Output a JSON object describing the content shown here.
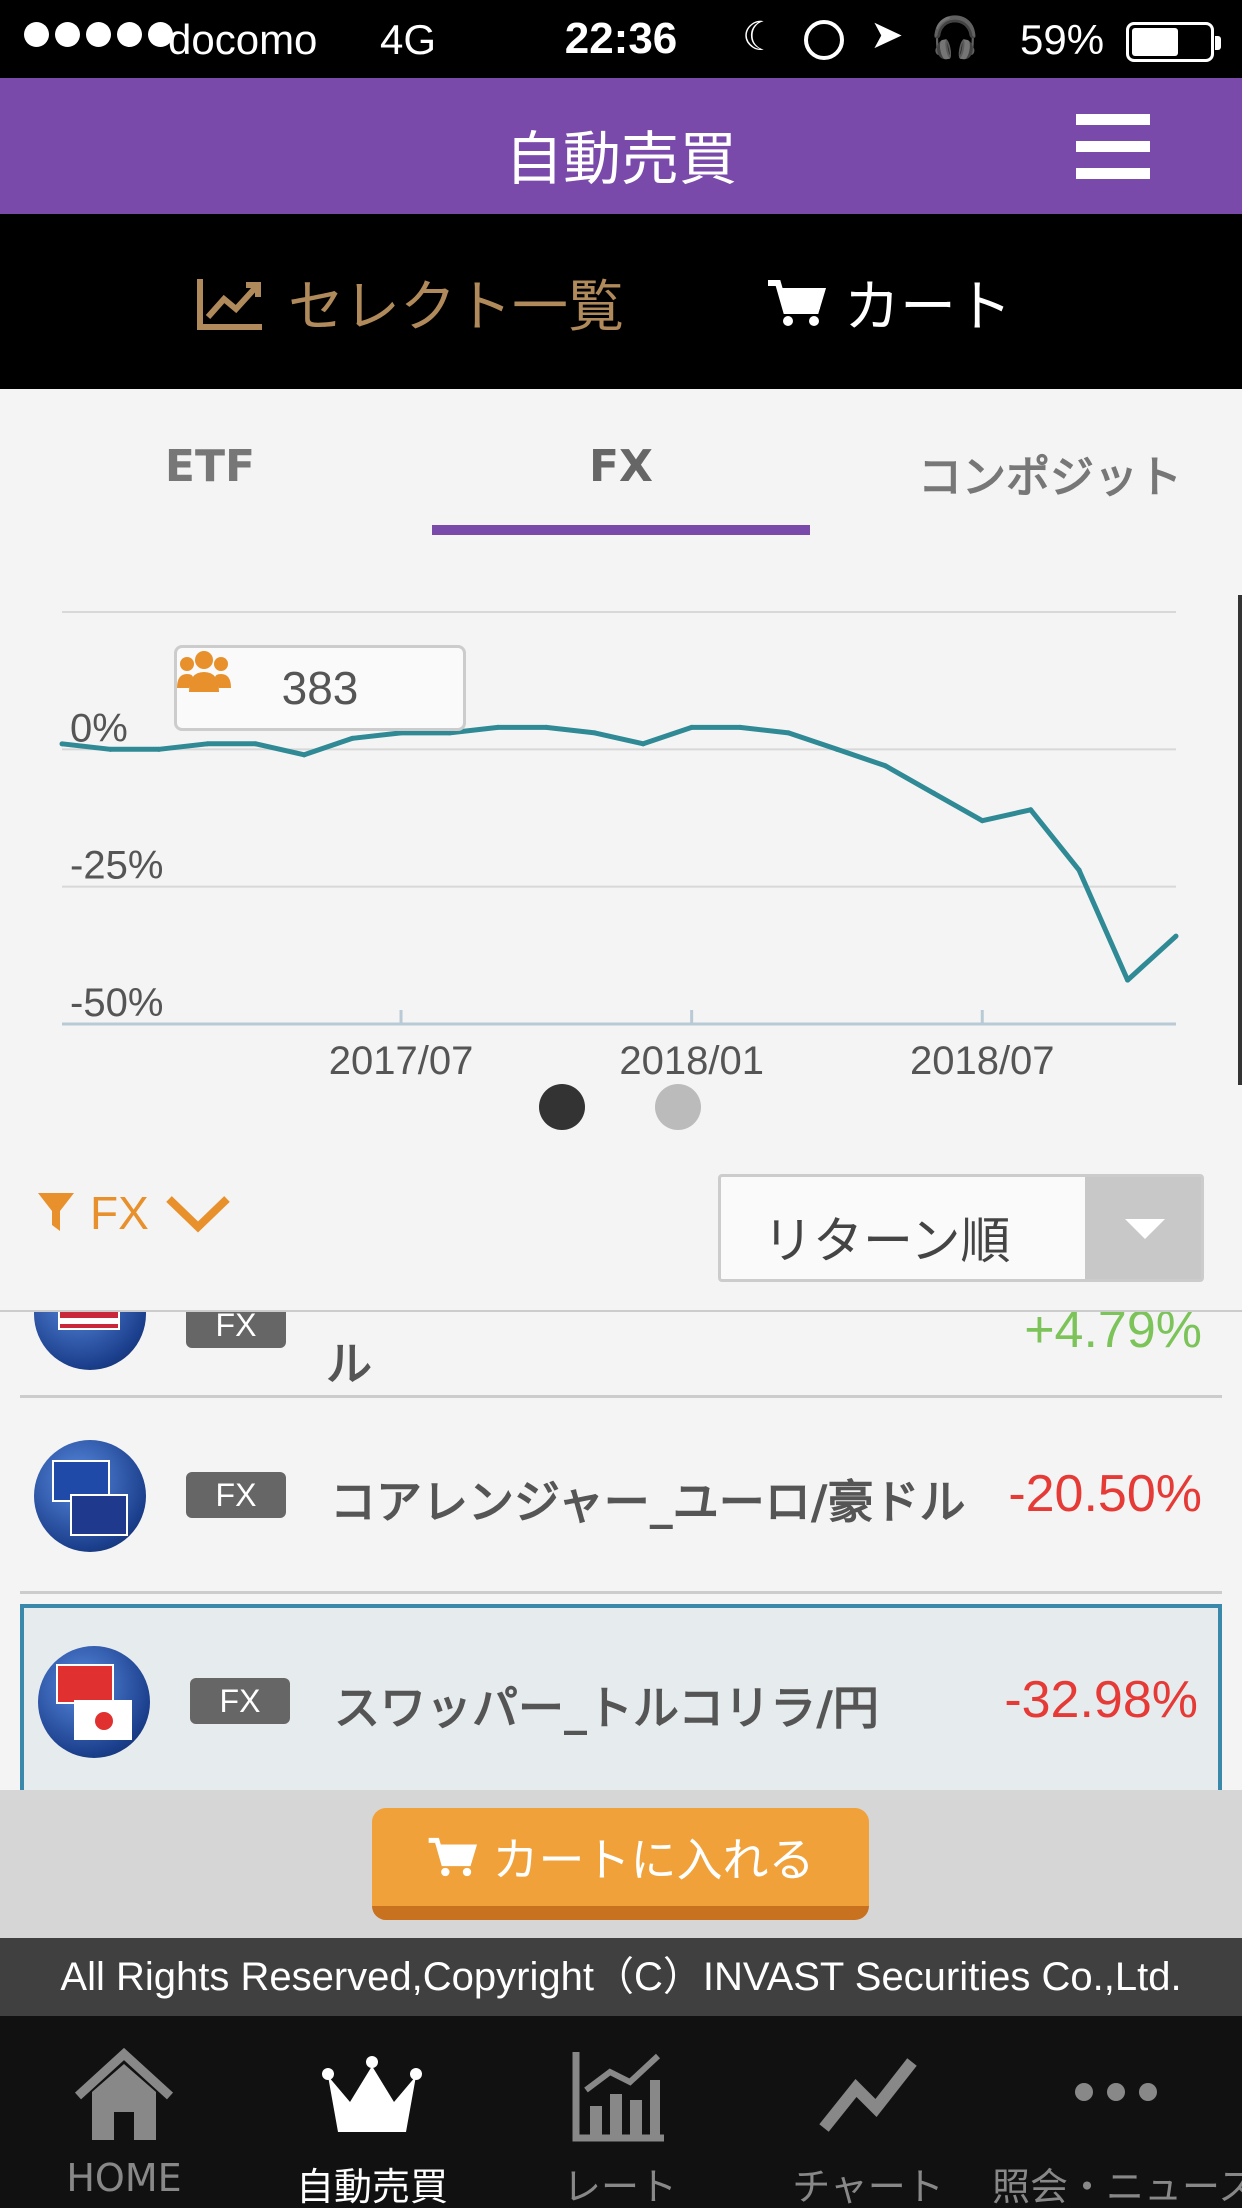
{
  "status_bar": {
    "carrier": "docomo",
    "network": "4G",
    "time": "22:36",
    "battery": "59%",
    "battery_level": 0.59
  },
  "header": {
    "title": "自動売買"
  },
  "select_bar": {
    "select_label": "セレクト一覧",
    "cart_label": "カート"
  },
  "tabs": [
    {
      "label": "ETF"
    },
    {
      "label": "FX"
    },
    {
      "label": "コンポジット"
    }
  ],
  "chart_badge": {
    "count": "383"
  },
  "chart_data": {
    "type": "line",
    "y_ticks": [
      "0%",
      "-25%",
      "-50%"
    ],
    "x_ticks": [
      "2017/07",
      "2018/01",
      "2018/07"
    ],
    "ylim": [
      -50,
      25
    ],
    "series": [
      {
        "x": [
          "2016/12",
          "2017/01",
          "2017/02",
          "2017/03",
          "2017/04",
          "2017/05",
          "2017/06",
          "2017/07",
          "2017/08",
          "2017/09",
          "2017/10",
          "2017/11",
          "2017/12",
          "2018/01",
          "2018/02",
          "2018/03",
          "2018/04",
          "2018/05",
          "2018/06",
          "2018/07",
          "2018/08",
          "2018/09",
          "2018/10",
          "2018/11"
        ],
        "values": [
          1,
          0,
          0,
          1,
          1,
          -1,
          2,
          3,
          3,
          4,
          4,
          3,
          1,
          4,
          4,
          3,
          0,
          -3,
          -8,
          -13,
          -11,
          -22,
          -42,
          -34
        ]
      }
    ],
    "line_color": "#2f8a96",
    "grid": true
  },
  "pagination": {
    "pages": 2,
    "active": 0
  },
  "filter": {
    "label": "FX"
  },
  "sort": {
    "label": "リターン順"
  },
  "list": [
    {
      "tag": "FX",
      "name": "ル",
      "return": "+4.79%",
      "color": "#7cc35a"
    },
    {
      "tag": "FX",
      "name": "コアレンジャー_ユーロ/豪ドル",
      "return": "-20.50%",
      "color": "#e53a36"
    },
    {
      "tag": "FX",
      "name": "スワッパー_トルコリラ/円",
      "return": "-32.98%",
      "color": "#e53a36"
    }
  ],
  "add_to_cart": {
    "label": "カートに入れる"
  },
  "copyright": "All Rights Reserved,Copyright（C）INVAST Securities Co.,Ltd.",
  "bottom_nav": [
    {
      "label": "HOME",
      "icon": "home-icon"
    },
    {
      "label": "自動売買",
      "icon": "crown-icon"
    },
    {
      "label": "レート",
      "icon": "bar-chart-icon"
    },
    {
      "label": "チャート",
      "icon": "line-chart-icon"
    },
    {
      "label": "照会・ニュース",
      "icon": "more-icon"
    }
  ],
  "colors": {
    "accent": "#7a4aab",
    "gold": "#b08a5a",
    "orange": "#f0a13a",
    "down": "#e53a36",
    "up": "#7cc35a"
  }
}
